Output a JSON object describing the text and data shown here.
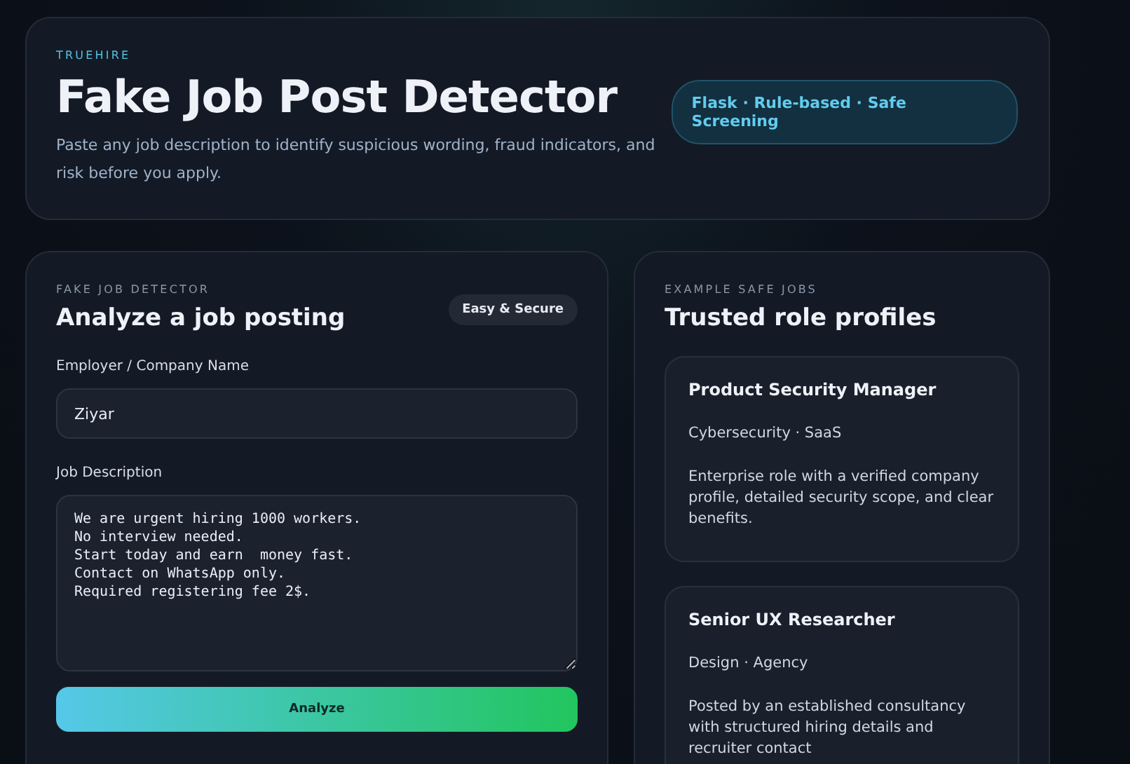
{
  "header": {
    "eyebrow": "TRUEHIRE",
    "title": "Fake Job Post Detector",
    "subtitle": "Paste any job description to identify suspicious wording, fraud indicators, and risk before you apply.",
    "badge": "Flask · Rule-based · Safe Screening"
  },
  "detector": {
    "eyebrow": "FAKE JOB DETECTOR",
    "title": "Analyze a job posting",
    "badge": "Easy & Secure",
    "fields": [
      {
        "kind": "input",
        "label": "Employer / Company Name",
        "value": "Ziyar"
      },
      {
        "kind": "textarea",
        "label": "Job Description",
        "value": "We are urgent hiring 1000 workers.\nNo interview needed.\nStart today and earn  money fast.\nContact on WhatsApp only.\nRequired registering fee 2$."
      }
    ],
    "button": "Analyze"
  },
  "examples": {
    "eyebrow": "EXAMPLE SAFE JOBS",
    "title": "Trusted role profiles",
    "jobs": [
      {
        "title": "Product Security Manager",
        "meta": "Cybersecurity · SaaS",
        "description": "Enterprise role with a verified company profile, detailed security scope, and clear benefits."
      },
      {
        "title": "Senior UX Researcher",
        "meta": "Design · Agency",
        "description": "Posted by an established consultancy with structured hiring details and recruiter contact"
      }
    ]
  }
}
